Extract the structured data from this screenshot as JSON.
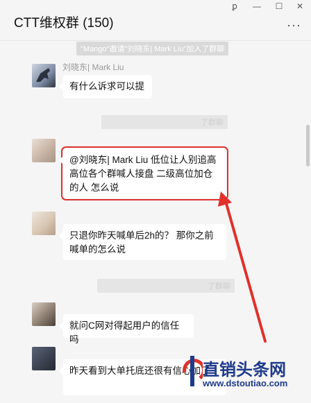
{
  "window": {
    "title": "CTT维权群 (150)",
    "controls": [
      "ꝑ",
      "—",
      "☐",
      "✕"
    ],
    "more": "···"
  },
  "notes": [
    {
      "text": "\"Mango\"邀请\"刘晓东| Mark Liu\"加入了群聊"
    },
    {
      "text": "了群聊"
    },
    {
      "text": "了群聊"
    }
  ],
  "messages": [
    {
      "nick": "刘晓东| Mark Liu",
      "text": "有什么诉求可以提"
    },
    {
      "nick": "",
      "text": "@刘晓东| Mark Liu  低位让人别追高 高位各个群喊人接盘 二级高位加仓的人 怎么说"
    },
    {
      "nick": "",
      "text": "只退你昨天喊单后2h的？ 那你之前喊单的怎么说"
    },
    {
      "nick": "",
      "text": "就问C网对得起用户的信任吗"
    },
    {
      "nick": "",
      "text": "昨天看到大单托底还很有信心加了"
    }
  ],
  "watermark": {
    "name": "直销头条网",
    "url": "www.dstoutiao.com"
  },
  "colors": {
    "highlight": "#e0312b",
    "arrow": "#e0312b"
  }
}
